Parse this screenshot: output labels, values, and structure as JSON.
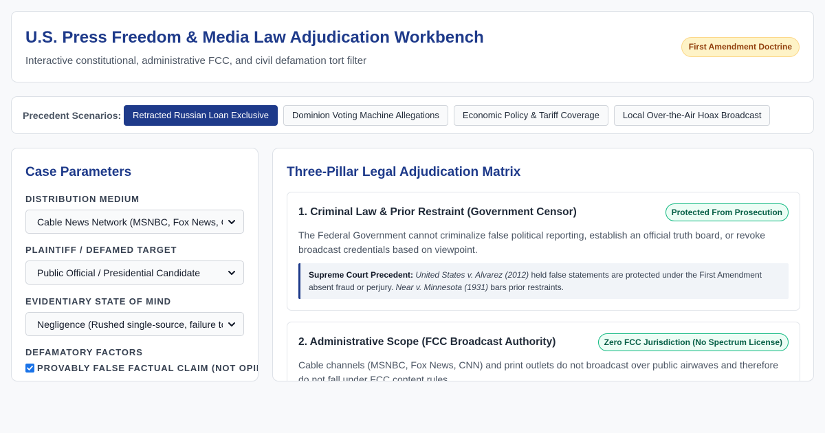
{
  "header": {
    "title": "U.S. Press Freedom & Media Law Adjudication Workbench",
    "subtitle": "Interactive constitutional, administrative FCC, and civil defamation tort filter",
    "badge": "First Amendment Doctrine"
  },
  "scenarios": {
    "label": "Precedent Scenarios:",
    "tabs": [
      {
        "label": "Retracted Russian Loan Exclusive",
        "active": true
      },
      {
        "label": "Dominion Voting Machine Allegations",
        "active": false
      },
      {
        "label": "Economic Policy & Tariff Coverage",
        "active": false
      },
      {
        "label": "Local Over-the-Air Hoax Broadcast",
        "active": false
      }
    ]
  },
  "params": {
    "title": "Case Parameters",
    "medium": {
      "label": "Distribution Medium",
      "value": "Cable News Network (MSNBC, Fox News, CNN)"
    },
    "plaintiff": {
      "label": "Plaintiff / Defamed Target",
      "value": "Public Official / Presidential Candidate"
    },
    "state_of_mind": {
      "label": "Evidentiary State of Mind",
      "value": "Negligence (Rushed single-source, failure to verify)"
    },
    "factors": {
      "label": "Defamatory Factors",
      "items": [
        {
          "label": "Provably False Factual Claim (Not Opinion)",
          "checked": true
        }
      ]
    }
  },
  "matrix": {
    "title": "Three-Pillar Legal Adjudication Matrix",
    "pillars": [
      {
        "title": "1. Criminal Law & Prior Restraint (Government Censor)",
        "badge": "Protected From Prosecution",
        "description": "The Federal Government cannot criminalize false political reporting, establish an official truth board, or revoke broadcast credentials based on viewpoint.",
        "precedent": {
          "label": "Supreme Court Precedent:",
          "case1": "United States v. Alvarez (2012)",
          "text1": " held false statements are protected under the First Amendment absent fraud or perjury. ",
          "case2": "Near v. Minnesota (1931)",
          "text2": " bars prior restraints."
        }
      },
      {
        "title": "2. Administrative Scope (FCC Broadcast Authority)",
        "badge": "Zero FCC Jurisdiction (No Spectrum License)",
        "description": "Cable channels (MSNBC, Fox News, CNN) and print outlets do not broadcast over public airwaves and therefore do not fall under FCC content rules."
      }
    ]
  },
  "colors": {
    "accent": "#1e3a8a",
    "badge_warning_bg": "#fef3c7",
    "badge_success_border": "#10b981",
    "checkbox": "#1a73e8"
  }
}
